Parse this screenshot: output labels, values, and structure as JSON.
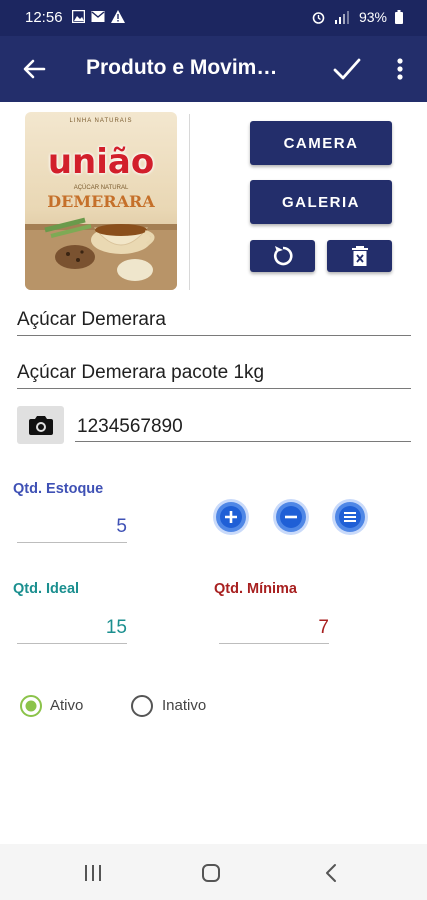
{
  "status_bar": {
    "time": "12:56",
    "battery": "93%",
    "icons": [
      "image-icon",
      "mail-icon",
      "warning-icon",
      "alarm-icon",
      "signal-icon",
      "battery-icon"
    ]
  },
  "app_bar": {
    "title": "Produto e Movim…",
    "icons": [
      "back-arrow-icon",
      "check-icon",
      "more-vert-icon"
    ]
  },
  "product": {
    "image_brand": "união",
    "image_name": "DEMERARA",
    "image_tagline": "LINHA NATURAIS",
    "image_subtitle": "AÇÚCAR NATURAL"
  },
  "buttons": {
    "camera": "CAMERA",
    "gallery": "GALERIA",
    "rotate_icon": "rotate-icon",
    "delete_icon": "delete-icon"
  },
  "fields": {
    "name": "Açúcar Demerara",
    "description": "Açúcar Demerara pacote 1kg",
    "barcode": "1234567890"
  },
  "stock": {
    "label": "Qtd. Estoque",
    "value": "5",
    "actions": [
      "plus-icon",
      "minus-icon",
      "list-icon"
    ]
  },
  "ideal": {
    "label": "Qtd. Ideal",
    "value": "15"
  },
  "minimum": {
    "label": "Qtd. Mínima",
    "value": "7"
  },
  "status": {
    "options": [
      "Ativo",
      "Inativo"
    ],
    "selected": "Ativo"
  },
  "colors": {
    "primary": "#232e6b",
    "status_bar": "#1c2660",
    "stock_color": "#3f51b5",
    "ideal_color": "#1b8f8f",
    "minimum_color": "#a82020",
    "radio_selected": "#8bc34a",
    "action_blue": "#4f87e6"
  }
}
